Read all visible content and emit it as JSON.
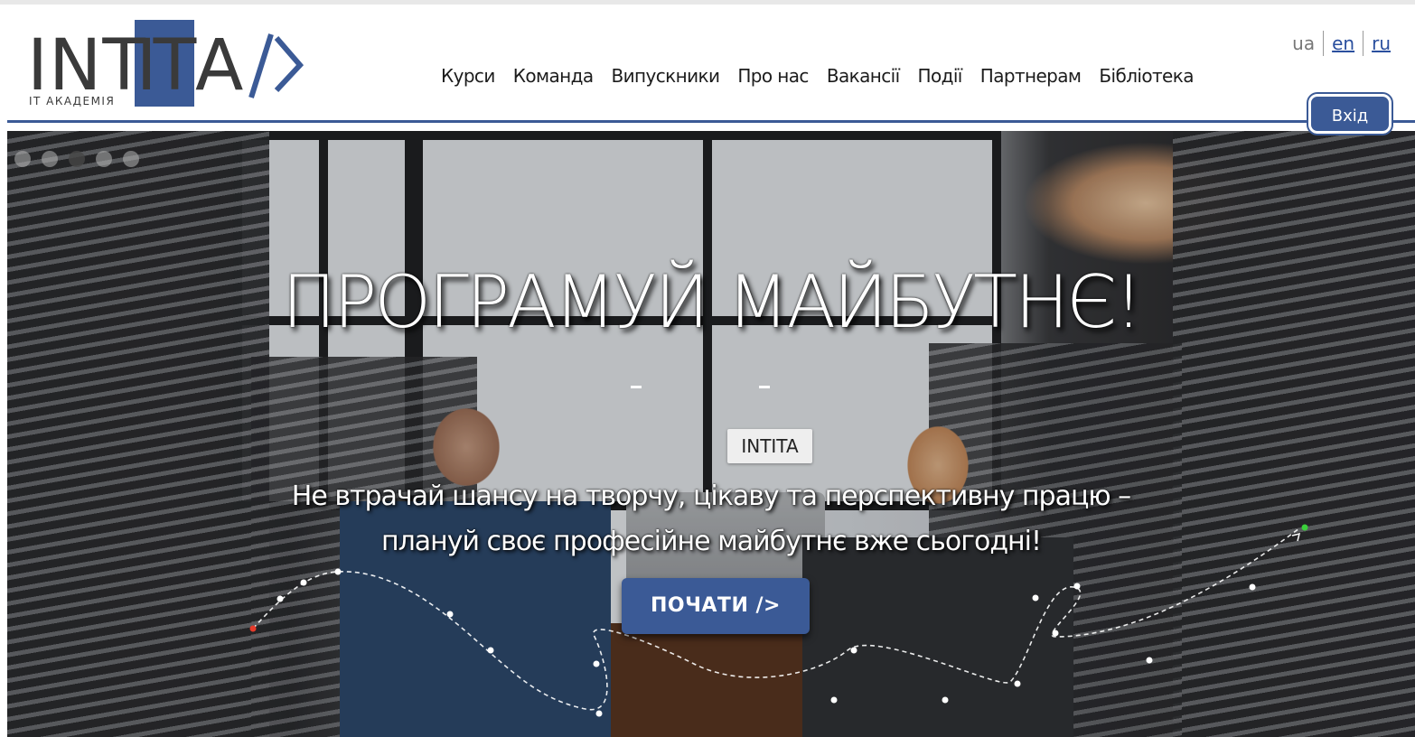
{
  "logo": {
    "int": "INT",
    "it": "IT",
    "a": "A",
    "subtitle": "IT АКАДЕМІЯ"
  },
  "nav": {
    "items": [
      "Курси",
      "Команда",
      "Випускники",
      "Про нас",
      "Вакансії",
      "Події",
      "Партнерам",
      "Бібліотека"
    ]
  },
  "lang": {
    "current": "ua",
    "options": [
      "en",
      "ru"
    ]
  },
  "login_label": "Вхід",
  "hero": {
    "title": "ПРОГРАМУЙ МАЙБУТНЄ!",
    "badge": "INTITA",
    "subtitle_line1": "Не втрачай шансу на творчу, цікаву та перспективну працю –",
    "subtitle_line2": "плануй своє професійне майбутнє вже сьогодні!",
    "cta_label": "ПОЧАТИ />",
    "slides_count": 5,
    "active_slide": 3
  },
  "colors": {
    "brand": "#3b5a96",
    "text": "#1c1c1c",
    "link": "#2a4f9e"
  }
}
